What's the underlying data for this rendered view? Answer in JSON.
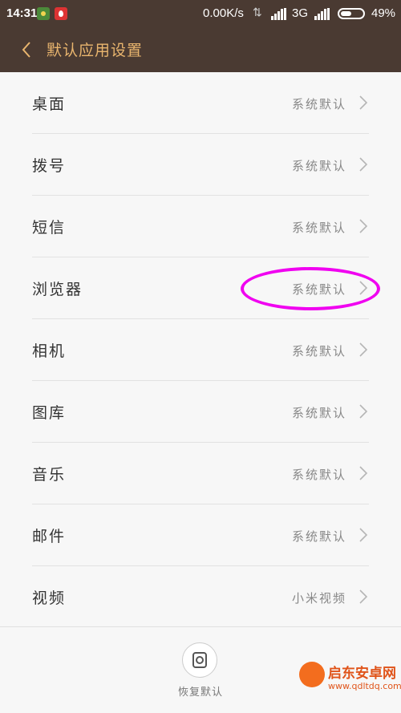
{
  "status_bar": {
    "time": "14:31",
    "net_speed": "0.00K/s",
    "network_type": "3G",
    "battery_percent": "49%",
    "battery_level": 0.49,
    "notification_icons": [
      "green-app-icon",
      "red-droplet-icon"
    ]
  },
  "header": {
    "back_icon": "chevron-left-icon",
    "title": "默认应用设置",
    "title_color": "#e9b56e",
    "background": "#4a3a32"
  },
  "items": [
    {
      "label": "桌面",
      "value": "系统默认"
    },
    {
      "label": "拨号",
      "value": "系统默认"
    },
    {
      "label": "短信",
      "value": "系统默认"
    },
    {
      "label": "浏览器",
      "value": "系统默认"
    },
    {
      "label": "相机",
      "value": "系统默认"
    },
    {
      "label": "图库",
      "value": "系统默认"
    },
    {
      "label": "音乐",
      "value": "系统默认"
    },
    {
      "label": "邮件",
      "value": "系统默认"
    },
    {
      "label": "视频",
      "value": "小米视频"
    }
  ],
  "highlight_color": "#f000f0",
  "bottom": {
    "restore_label": "恢复默认",
    "restore_icon": "restore-icon"
  },
  "watermark": {
    "name": "启东安卓网",
    "url": "www.qdltdq.com"
  }
}
